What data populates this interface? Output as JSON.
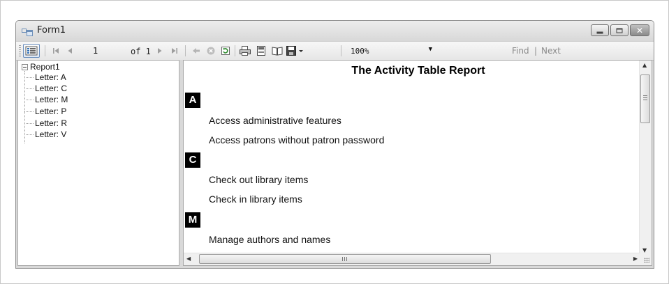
{
  "window": {
    "title": "Form1"
  },
  "toolbar": {
    "page_number": "1",
    "of_pages": "of 1",
    "zoom": "100%",
    "find_label": "Find",
    "find_separator": "|",
    "next_label": "Next",
    "icons": [
      "document-map-icon",
      "first-page-icon",
      "previous-page-icon",
      "next-page-icon",
      "last-page-icon",
      "back-icon",
      "stop-icon",
      "refresh-icon",
      "print-icon",
      "print-layout-icon",
      "page-setup-icon",
      "export-icon"
    ]
  },
  "document_map": {
    "root": "Report1",
    "items": [
      "Letter: A",
      "Letter: C",
      "Letter: M",
      "Letter: P",
      "Letter: R",
      "Letter: V"
    ]
  },
  "report": {
    "title": "The Activity Table Report",
    "groups": [
      {
        "letter": "A",
        "items": [
          "Access administrative features",
          "Access patrons without patron password"
        ]
      },
      {
        "letter": "C",
        "items": [
          "Check out library items",
          "Check in library items"
        ]
      },
      {
        "letter": "M",
        "items": [
          "Manage authors and names"
        ]
      }
    ]
  },
  "scrollbars": {
    "horizontal_grip": "III"
  },
  "colors": {
    "badge_background": "#000000",
    "badge_text": "#ffffff",
    "window_chrome": "#d9d9d9",
    "disabled_text": "#8a8a8a"
  }
}
